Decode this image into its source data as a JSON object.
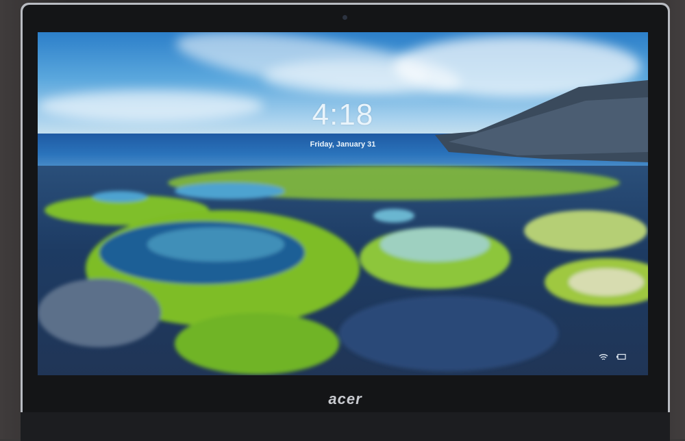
{
  "lock_screen": {
    "time": "4:18",
    "date": "Friday, January 31"
  },
  "status_icons": [
    "wifi-icon",
    "battery-icon"
  ],
  "device": {
    "brand_logo": "acer"
  }
}
